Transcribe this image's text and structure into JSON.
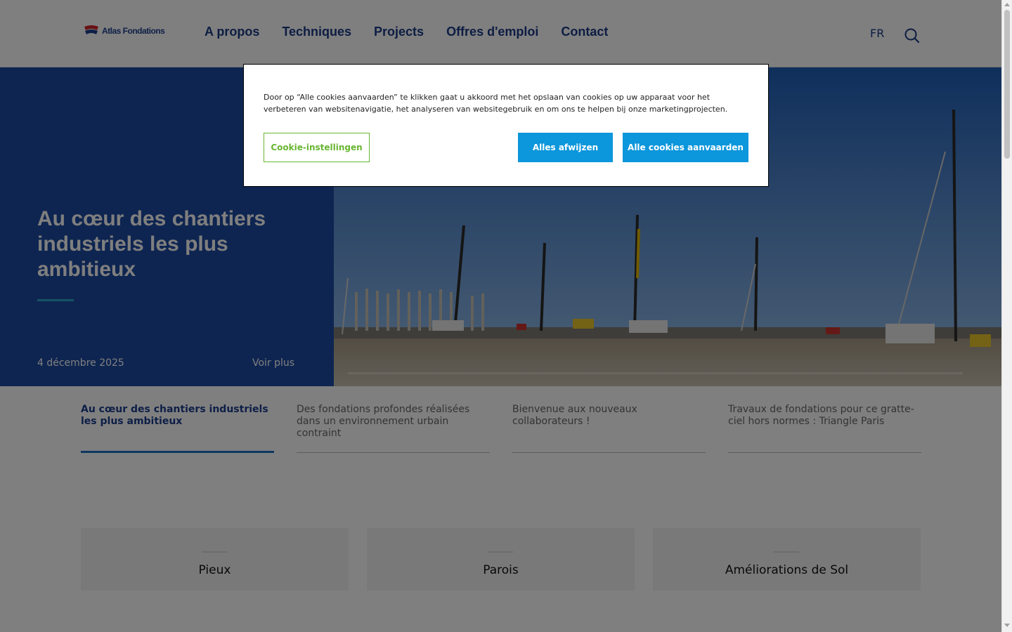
{
  "header": {
    "logo_text": "Atlas Fondations",
    "nav": [
      "A propos",
      "Techniques",
      "Projects",
      "Offres d'emploi",
      "Contact"
    ],
    "lang": "FR"
  },
  "hero": {
    "title": "Au cœur des chantiers industriels les plus ambitieux",
    "date": "4 décembre 2025",
    "more_label": "Voir plus"
  },
  "tabs": [
    {
      "label": "Au cœur des chantiers industriels les plus ambitieux",
      "active": true
    },
    {
      "label": "Des fondations profondes réalisées dans un environnement urbain contraint",
      "active": false
    },
    {
      "label": "Bienvenue aux nouveaux collaborateurs !",
      "active": false
    },
    {
      "label": "Travaux de fondations pour ce gratte-ciel hors normes : Triangle Paris",
      "active": false
    }
  ],
  "cards": [
    "Pieux",
    "Parois",
    "Améliorations de Sol"
  ],
  "cookie": {
    "text": "Door op “Alle cookies aanvaarden” te klikken gaat u akkoord met het opslaan van cookies op uw apparaat voor het verbeteren van websitenavigatie, het analyseren van websitegebruik en om ons te helpen bij onze marketingprojecten.",
    "settings_label": "Cookie-instellingen",
    "reject_label": "Alles afwijzen",
    "accept_label": "Alle cookies aanvaarden"
  },
  "colors": {
    "brand_blue": "#1d4ba3",
    "nav_text": "#1b3a86",
    "accent_cyan": "#2ca9cf",
    "cookie_button": "#0c96db",
    "cookie_settings": "#68b631"
  }
}
